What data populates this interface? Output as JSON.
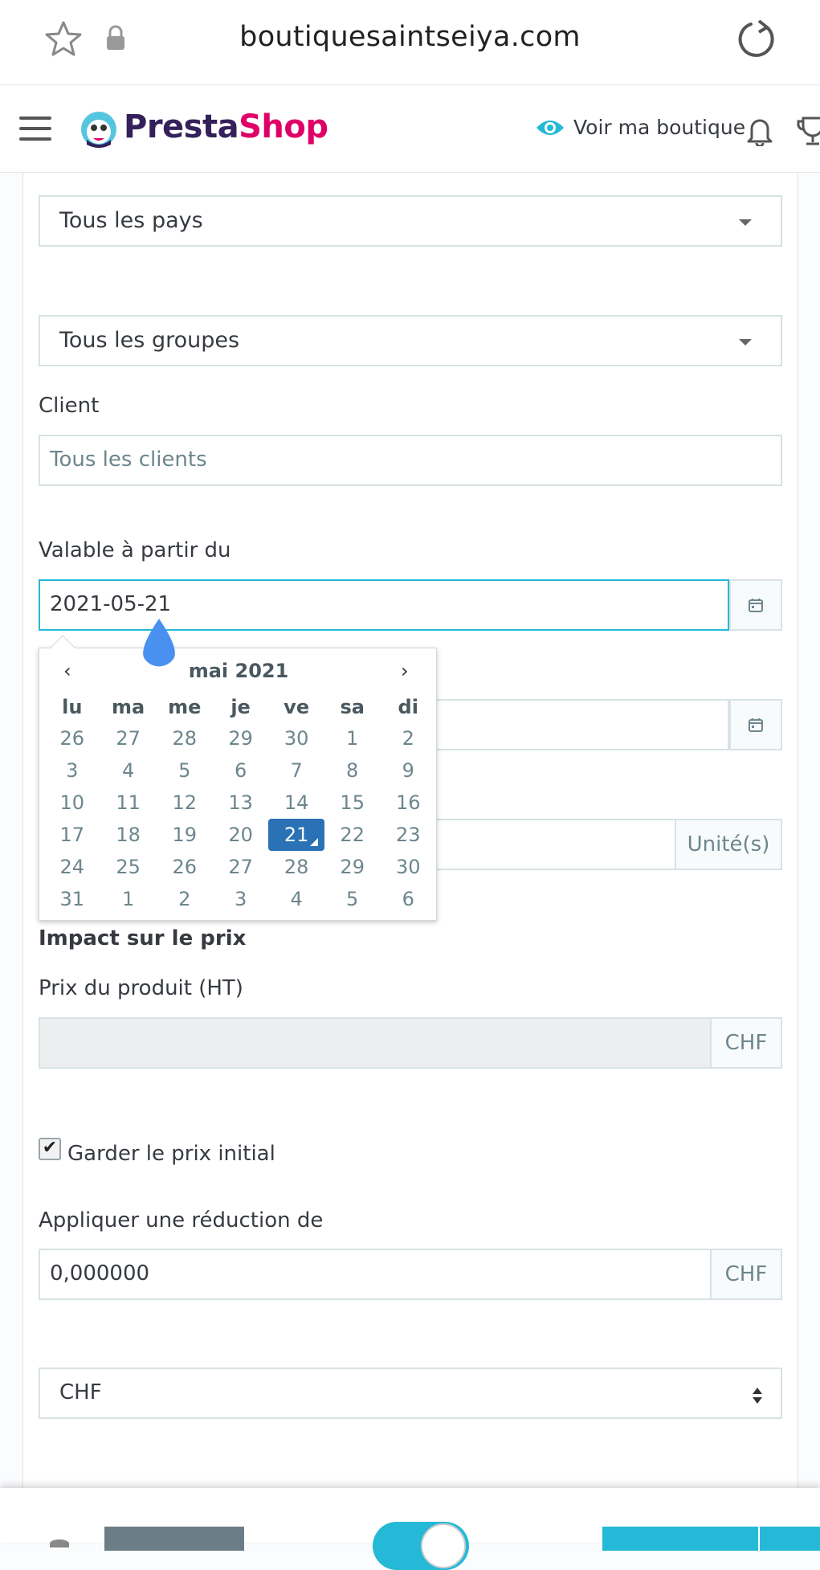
{
  "browser": {
    "url": "boutiquesaintseiya.com"
  },
  "header": {
    "logo_part1": "Presta",
    "logo_part2": "Shop",
    "view_shop_label": "Voir ma boutique"
  },
  "form": {
    "country_select": "Tous les pays",
    "group_select": "Tous les groupes",
    "client_label": "Client",
    "client_placeholder": "Tous les clients",
    "valid_from_label": "Valable à partir du",
    "valid_from_value": "2021-05-21",
    "units_addon": "Unité(s)",
    "price_impact_heading": "Impact sur le prix",
    "product_price_label": "Prix du produit (HT)",
    "product_price_value": "",
    "currency_addon": "CHF",
    "keep_initial_price_label": "Garder le prix initial",
    "keep_initial_price_checked": true,
    "apply_discount_label": "Appliquer une réduction de",
    "discount_value": "0,000000",
    "discount_currency_addon": "CHF",
    "currency_select": "CHF"
  },
  "datepicker": {
    "prev": "‹",
    "next": "›",
    "month_title": "mai 2021",
    "weekdays": [
      "lu",
      "ma",
      "me",
      "je",
      "ve",
      "sa",
      "di"
    ],
    "weeks": [
      [
        "26",
        "27",
        "28",
        "29",
        "30",
        "1",
        "2"
      ],
      [
        "3",
        "4",
        "5",
        "6",
        "7",
        "8",
        "9"
      ],
      [
        "10",
        "11",
        "12",
        "13",
        "14",
        "15",
        "16"
      ],
      [
        "17",
        "18",
        "19",
        "20",
        "21",
        "22",
        "23"
      ],
      [
        "24",
        "25",
        "26",
        "27",
        "28",
        "29",
        "30"
      ],
      [
        "31",
        "1",
        "2",
        "3",
        "4",
        "5",
        "6"
      ]
    ],
    "selected_day": "21"
  },
  "colors": {
    "accent": "#25b9d7",
    "selected_day": "#2a72b5",
    "brand_dark": "#34215b",
    "brand_pink": "#df0067"
  }
}
